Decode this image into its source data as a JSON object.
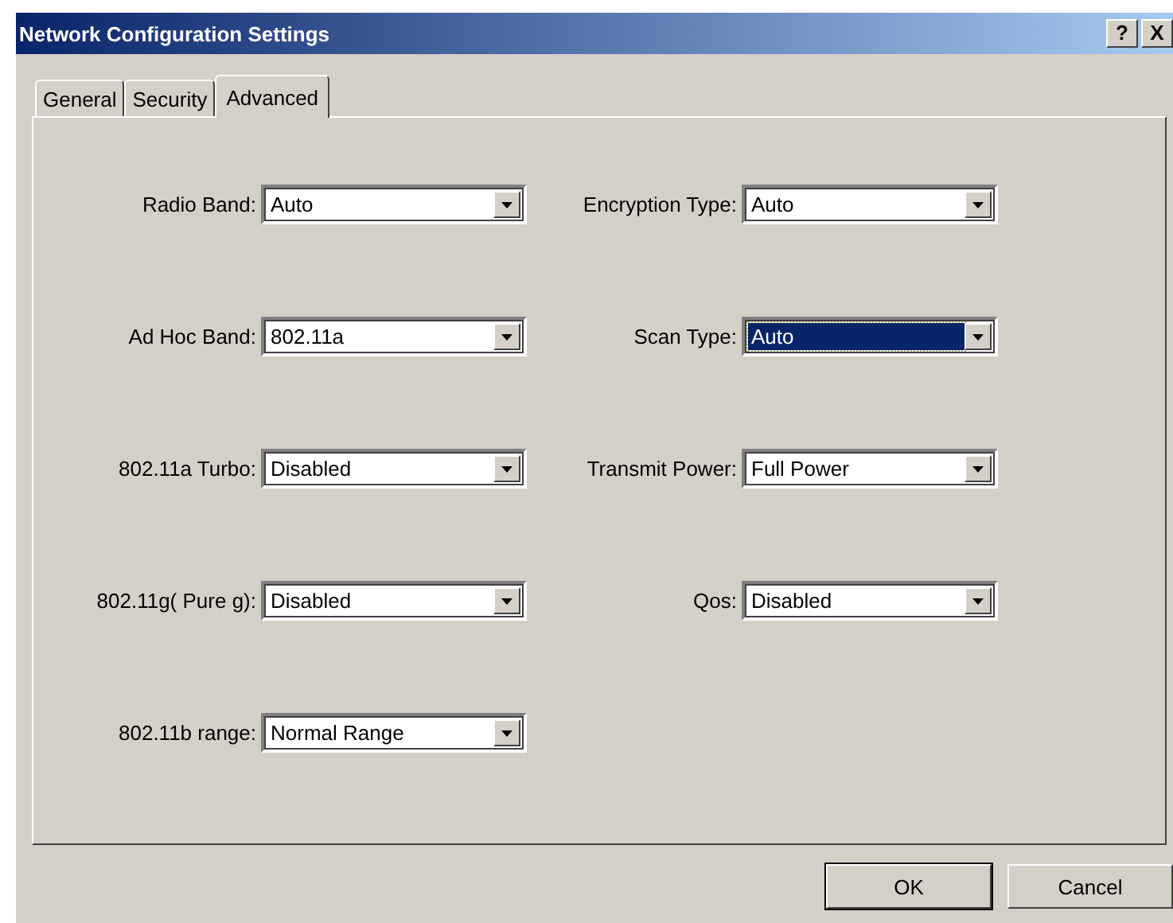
{
  "window": {
    "title": "Network Configuration Settings",
    "title_buttons": [
      "?",
      "X"
    ]
  },
  "tabs": [
    {
      "label": "General",
      "selected": false
    },
    {
      "label": "Security",
      "selected": false
    },
    {
      "label": "Advanced",
      "selected": true
    }
  ],
  "left_fields": [
    {
      "label": "Radio Band:",
      "value": "Auto",
      "focused": false
    },
    {
      "label": "Ad Hoc Band:",
      "value": "802.11a",
      "focused": false
    },
    {
      "label": "802.11a Turbo:",
      "value": "Disabled",
      "focused": false
    },
    {
      "label": "802.11g( Pure g):",
      "value": "Disabled",
      "focused": false
    },
    {
      "label": "802.11b range:",
      "value": "Normal Range",
      "focused": false
    }
  ],
  "right_fields": [
    {
      "label": "Encryption Type:",
      "value": "Auto",
      "focused": false
    },
    {
      "label": "Scan Type:",
      "value": "Auto",
      "focused": true
    },
    {
      "label": "Transmit Power:",
      "value": "Full Power",
      "focused": false
    },
    {
      "label": "Qos:",
      "value": "Disabled",
      "focused": false
    }
  ],
  "buttons": [
    "OK",
    "Cancel"
  ]
}
